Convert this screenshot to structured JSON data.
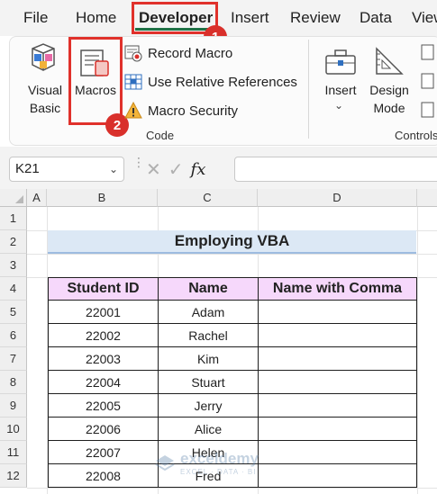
{
  "tabs": [
    {
      "label": "File"
    },
    {
      "label": "Home"
    },
    {
      "label": "Developer"
    },
    {
      "label": "Insert"
    },
    {
      "label": "Review"
    },
    {
      "label": "Data"
    },
    {
      "label": "View"
    }
  ],
  "active_tab": "Developer",
  "ribbon": {
    "code_group": {
      "label": "Code",
      "visual_basic": "Visual Basic",
      "macros": "Macros",
      "record_macro": "Record Macro",
      "use_relative_references": "Use Relative References",
      "macro_security": "Macro Security"
    },
    "controls_group": {
      "label": "Controls",
      "insert": "Insert",
      "design_mode": "Design Mode"
    }
  },
  "annotations": {
    "step1": "1",
    "step2": "2",
    "color": "#e0312b"
  },
  "formula_bar": {
    "name_box": "K21",
    "fx": "fx",
    "value": ""
  },
  "sheet": {
    "columns": [
      "A",
      "B",
      "C",
      "D"
    ],
    "rows": [
      "1",
      "2",
      "3",
      "4",
      "5",
      "6",
      "7",
      "8",
      "9",
      "10",
      "11",
      "12"
    ],
    "title": "Employing VBA",
    "table": {
      "headers": [
        "Student ID",
        "Name",
        "Name with Comma"
      ],
      "rows": [
        {
          "id": "22001",
          "name": "Adam",
          "comma": ""
        },
        {
          "id": "22002",
          "name": "Rachel",
          "comma": ""
        },
        {
          "id": "22003",
          "name": "Kim",
          "comma": ""
        },
        {
          "id": "22004",
          "name": "Stuart",
          "comma": ""
        },
        {
          "id": "22005",
          "name": "Jerry",
          "comma": ""
        },
        {
          "id": "22006",
          "name": "Alice",
          "comma": ""
        },
        {
          "id": "22007",
          "name": "Helen",
          "comma": ""
        },
        {
          "id": "22008",
          "name": "Fred",
          "comma": ""
        }
      ]
    },
    "header_fill": "#f6d8fb",
    "title_fill": "#dce8f5"
  },
  "watermark": {
    "name": "exceldemy",
    "sub": "EXCEL · DATA · BI"
  },
  "colors": {
    "accent_green": "#1e7145",
    "annotation_red": "#e0312b"
  }
}
